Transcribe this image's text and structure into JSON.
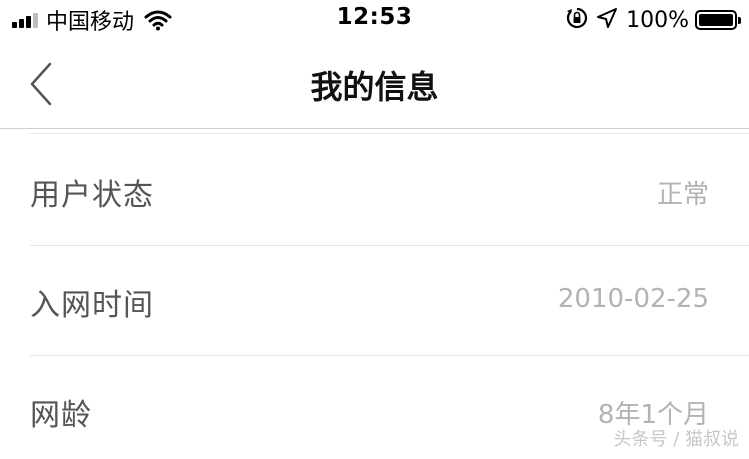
{
  "status_bar": {
    "carrier": "中国移动",
    "time": "12:53",
    "battery": "100%"
  },
  "nav": {
    "title": "我的信息"
  },
  "rows": [
    {
      "label": "用户状态",
      "value": "正常"
    },
    {
      "label": "入网时间",
      "value": "2010-02-25"
    },
    {
      "label": "网龄",
      "value": "8年1个月"
    }
  ],
  "watermark": "头条号 / 猫叔说"
}
